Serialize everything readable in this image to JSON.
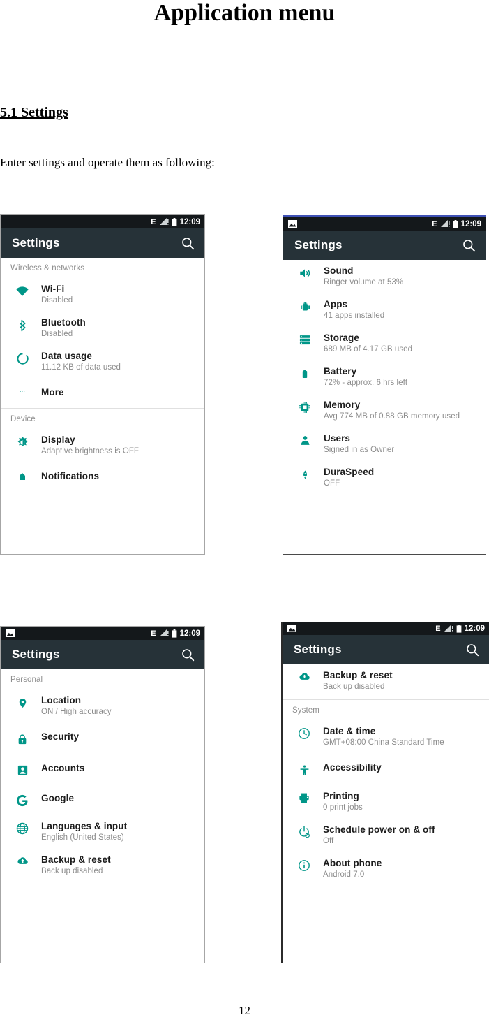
{
  "document": {
    "title": "Application menu",
    "section_heading": "5.1 Settings",
    "body_text": "Enter settings and operate them as following:",
    "page_number": "12"
  },
  "theme": {
    "accent": "#009688",
    "appbar_bg": "#263238",
    "statusbar_bg": "#14181b",
    "title_color": "#1c1c1c",
    "subtitle_color": "#8c8c8c",
    "section_color": "#8e8e8e"
  },
  "status_bar": {
    "network_label": "E",
    "clock": "12:09",
    "icons": [
      "screenshot-icon",
      "edge-network-icon",
      "signal-icon",
      "battery-icon"
    ]
  },
  "app_bar": {
    "title": "Settings",
    "search_icon": "search-icon"
  },
  "screens": [
    {
      "id": "settings-wireless-device",
      "has_notification_icon": false,
      "groups": [
        {
          "header": "Wireless & networks",
          "items": [
            {
              "icon": "wifi-icon",
              "title": "Wi-Fi",
              "subtitle": "Disabled"
            },
            {
              "icon": "bluetooth-icon",
              "title": "Bluetooth",
              "subtitle": "Disabled"
            },
            {
              "icon": "data-usage-icon",
              "title": "Data usage",
              "subtitle": "11.12 KB of data used"
            },
            {
              "icon": "more-icon",
              "title": "More",
              "subtitle": ""
            }
          ]
        },
        {
          "header": "Device",
          "items": [
            {
              "icon": "display-icon",
              "title": "Display",
              "subtitle": "Adaptive brightness is OFF"
            },
            {
              "icon": "notifications-icon",
              "title": "Notifications",
              "subtitle": ""
            }
          ]
        }
      ]
    },
    {
      "id": "settings-device-continued",
      "has_notification_icon": true,
      "groups": [
        {
          "header": "",
          "items": [
            {
              "icon": "sound-icon",
              "title": "Sound",
              "subtitle": "Ringer volume at 53%"
            },
            {
              "icon": "apps-icon",
              "title": "Apps",
              "subtitle": "41 apps installed"
            },
            {
              "icon": "storage-icon",
              "title": "Storage",
              "subtitle": "689 MB of 4.17 GB used"
            },
            {
              "icon": "battery-icon",
              "title": "Battery",
              "subtitle": "72% - approx. 6 hrs left"
            },
            {
              "icon": "memory-icon",
              "title": "Memory",
              "subtitle": "Avg 774 MB of 0.88 GB memory used"
            },
            {
              "icon": "users-icon",
              "title": "Users",
              "subtitle": "Signed in as Owner"
            },
            {
              "icon": "duraspeed-icon",
              "title": "DuraSpeed",
              "subtitle": "OFF"
            }
          ]
        }
      ]
    },
    {
      "id": "settings-personal",
      "has_notification_icon": true,
      "groups": [
        {
          "header": "Personal",
          "items": [
            {
              "icon": "location-icon",
              "title": "Location",
              "subtitle": "ON / High accuracy"
            },
            {
              "icon": "security-icon",
              "title": "Security",
              "subtitle": ""
            },
            {
              "icon": "accounts-icon",
              "title": "Accounts",
              "subtitle": ""
            },
            {
              "icon": "google-icon",
              "title": "Google",
              "subtitle": ""
            },
            {
              "icon": "language-icon",
              "title": "Languages & input",
              "subtitle": "English (United States)"
            },
            {
              "icon": "backup-icon",
              "title": "Backup & reset",
              "subtitle": "Back up disabled"
            }
          ]
        }
      ]
    },
    {
      "id": "settings-system",
      "has_notification_icon": true,
      "groups": [
        {
          "header": "",
          "items": [
            {
              "icon": "backup-icon",
              "title": "Backup & reset",
              "subtitle": "Back up disabled"
            }
          ]
        },
        {
          "header": "System",
          "items": [
            {
              "icon": "clock-icon",
              "title": "Date & time",
              "subtitle": "GMT+08:00 China Standard Time"
            },
            {
              "icon": "accessibility-icon",
              "title": "Accessibility",
              "subtitle": ""
            },
            {
              "icon": "printing-icon",
              "title": "Printing",
              "subtitle": "0 print jobs"
            },
            {
              "icon": "power-schedule-icon",
              "title": "Schedule power on & off",
              "subtitle": "Off"
            },
            {
              "icon": "about-icon",
              "title": "About phone",
              "subtitle": "Android 7.0"
            }
          ]
        }
      ]
    }
  ]
}
